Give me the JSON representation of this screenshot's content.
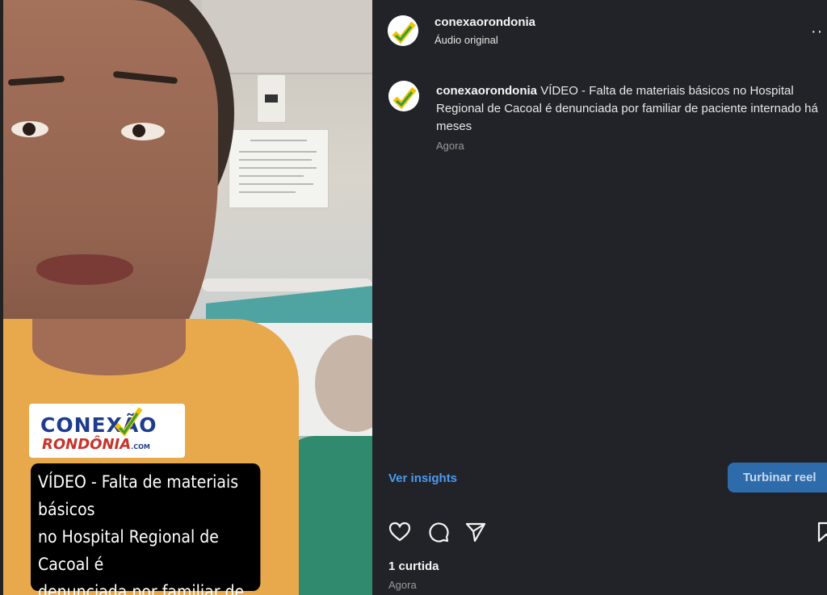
{
  "video": {
    "logo_line1": "CONEXÃO",
    "logo_line2": "RONDÔNIA",
    "logo_suffix": ".COM",
    "caption": "VÍDEO - Falta de materiais básicos\nno Hospital Regional de Cacoal é\ndenunciada por familiar de\npaciente internado há meses"
  },
  "header": {
    "username": "conexaorondonia",
    "audio": "Áudio original",
    "more_icon": "more-horizontal-icon"
  },
  "post": {
    "username": "conexaorondonia",
    "caption": "VÍDEO - Falta de materiais básicos no Hospital Regional de Cacoal é denunciada por familiar de paciente internado há meses",
    "time": "Agora"
  },
  "actions": {
    "insights_label": "Ver insights",
    "boost_label": "Turbinar reel",
    "like_icon": "heart-icon",
    "comment_icon": "comment-icon",
    "share_icon": "send-icon",
    "save_icon": "bookmark-icon"
  },
  "footer": {
    "likes": "1 curtida",
    "time": "Agora"
  },
  "colors": {
    "panel_bg": "#212328",
    "link_blue": "#4b9bf0",
    "boost_bg": "#2e6bab"
  }
}
